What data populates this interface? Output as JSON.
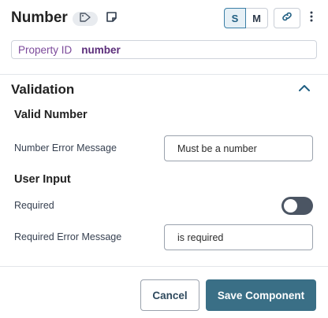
{
  "header": {
    "title": "Number",
    "tag_icon": "tag-icon",
    "note_icon": "note-icon",
    "size_options": [
      "S",
      "M"
    ],
    "size_selected": "S",
    "link_icon": "link-icon",
    "menu_icon": "kebab-icon"
  },
  "property": {
    "label": "Property ID",
    "value": "number"
  },
  "validation": {
    "title": "Validation",
    "collapse_icon": "chevron-up-icon",
    "valid_number": {
      "heading": "Valid Number",
      "error_label": "Number Error Message",
      "error_value": "Must be a number"
    },
    "user_input": {
      "heading": "User Input",
      "required_label": "Required",
      "required_on": false,
      "required_error_label": "Required Error Message",
      "required_error_value": "is required"
    }
  },
  "footer": {
    "cancel_label": "Cancel",
    "save_label": "Save Component"
  },
  "colors": {
    "primary": "#3a6f86",
    "property_text": "#7c4a9b",
    "toggle_off": "#4b5563"
  }
}
